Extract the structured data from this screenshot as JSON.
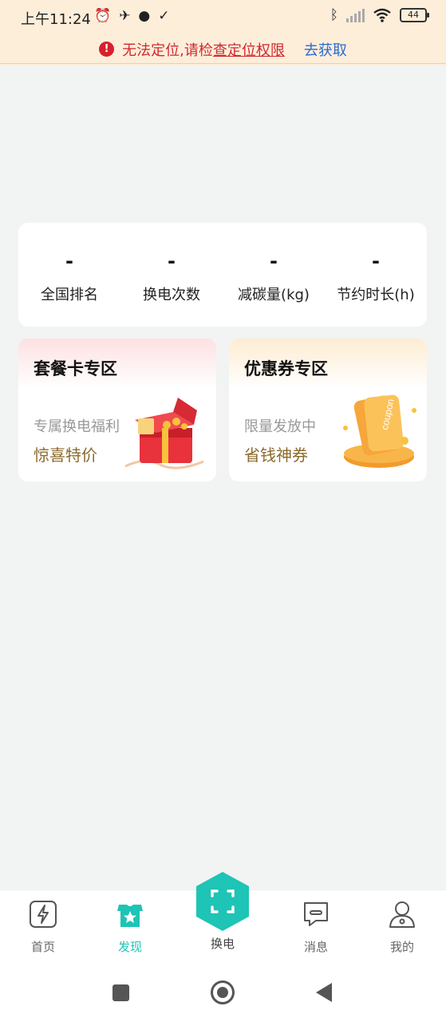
{
  "status_bar": {
    "time": "上午11:24",
    "battery": "44"
  },
  "alert": {
    "text_prefix": "无法定位,请检",
    "text_link": "查定位权限",
    "action": "去获取"
  },
  "stats": [
    {
      "value": "-",
      "label": "全国排名"
    },
    {
      "value": "-",
      "label": "换电次数"
    },
    {
      "value": "-",
      "label": "减碳量(kg)"
    },
    {
      "value": "-",
      "label": "节约时长(h)"
    }
  ],
  "promos": {
    "package": {
      "title": "套餐卡专区",
      "subtitle": "专属换电福利",
      "cta": "惊喜特价"
    },
    "coupon": {
      "title": "优惠券专区",
      "subtitle": "限量发放中",
      "cta": "省钱神券",
      "art_text": "coupon"
    }
  },
  "nav": {
    "home": "首页",
    "discover": "发现",
    "swap": "换电",
    "messages": "消息",
    "mine": "我的"
  },
  "colors": {
    "accent": "#1ec4b5",
    "alert": "#d0282f",
    "link": "#2a6bd1",
    "cta": "#8b6a2b"
  }
}
